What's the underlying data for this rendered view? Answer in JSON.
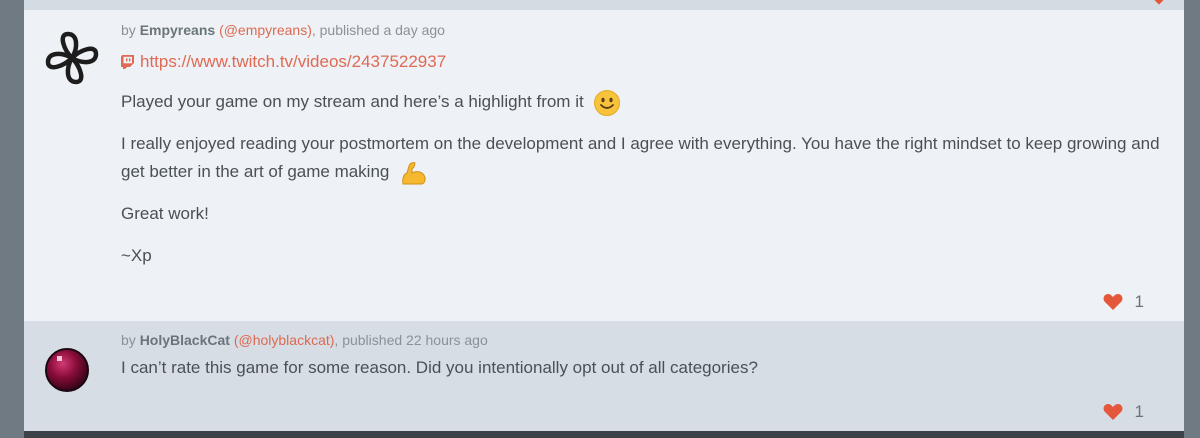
{
  "comments": [
    {
      "author": "Empyreans",
      "handle": "(@empyreans)",
      "published": ", published a day ago",
      "by": "by ",
      "link": "https://www.twitch.tv/videos/2437522937",
      "paragraphs": [
        "Played your game on my stream and here’s a highlight from it",
        "I really enjoyed reading your postmortem on the development and I agree with everything. You have the right mindset to keep growing and get better in the art of game making",
        "Great work!",
        "~Xp"
      ],
      "likes": "1"
    },
    {
      "author": "HolyBlackCat",
      "handle": "(@holyblackcat)",
      "published": ", published 22 hours ago",
      "by": "by ",
      "paragraphs": [
        "I can’t rate this game for some reason. Did you intentionally opt out of all categories?"
      ],
      "likes": "1"
    }
  ],
  "colors": {
    "accent": "#e06a55",
    "heart": "#e4573b",
    "comment_bg": "#eef1f5",
    "comment_alt_bg": "#d6dde5"
  },
  "icons": {
    "avatar1": "four-loop-knot-icon",
    "avatar2": "dark-red-sphere-icon",
    "link": "twitch-icon",
    "like": "heart-icon",
    "emoji1": "slightly-smiling-face-emoji",
    "emoji2": "flexed-biceps-emoji"
  }
}
